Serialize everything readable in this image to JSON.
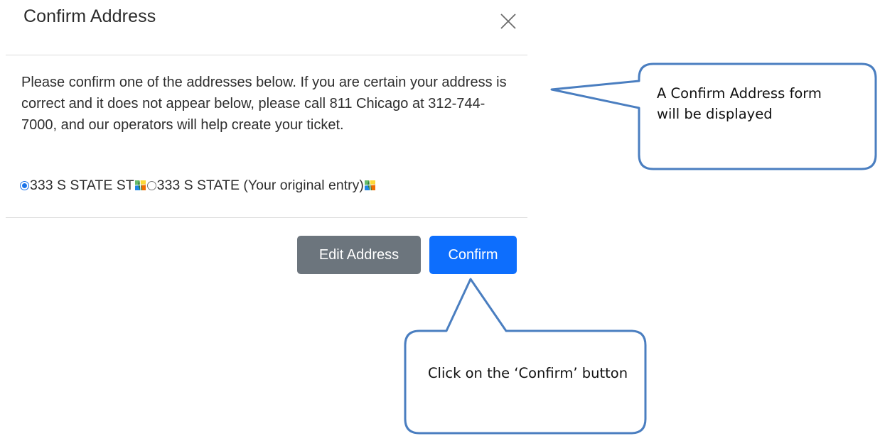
{
  "modal": {
    "title": "Confirm Address",
    "close_icon": "close-icon",
    "message": "Please confirm one of the addresses below. If you are certain your address is correct and it does not appear below, please call 811 Chicago at 312-744-7000, and our operators will help create your ticket.",
    "options": [
      {
        "label": "333 S STATE ST",
        "selected": true,
        "icon": "map-icon"
      },
      {
        "label": "333 S STATE (Your original entry)",
        "selected": false,
        "icon": "map-icon"
      }
    ],
    "buttons": {
      "edit_label": "Edit Address",
      "confirm_label": "Confirm"
    }
  },
  "annotations": {
    "form_callout": "A Confirm Address form will be displayed",
    "button_callout": "Click on the ‘Confirm’ button"
  },
  "colors": {
    "confirm_button": "#0d6efd",
    "edit_button": "#6c757d",
    "callout_border": "#4a7ec0"
  }
}
